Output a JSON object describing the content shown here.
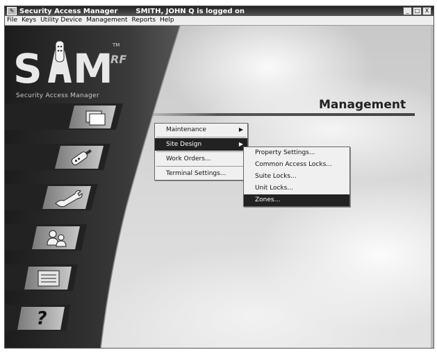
{
  "window": {
    "app_title": "Security Access Manager",
    "logged_on": "SMITH, JOHN Q is logged on",
    "buttons": {
      "minimize": "_",
      "maximize": "□",
      "close": "X"
    }
  },
  "menubar": [
    "File",
    "Keys",
    "Utility Device",
    "Management",
    "Reports",
    "Help"
  ],
  "logo": {
    "mark": "SAM",
    "trademark": "TM",
    "suffix": "RF",
    "tagline": "Security Access Manager"
  },
  "nav_tiles": [
    {
      "name": "folder-icon"
    },
    {
      "name": "key-device-icon"
    },
    {
      "name": "wrench-icon"
    },
    {
      "name": "users-icon"
    },
    {
      "name": "list-icon"
    },
    {
      "name": "help-icon",
      "glyph": "?"
    }
  ],
  "section": {
    "title": "Management"
  },
  "management_menu": {
    "items": [
      {
        "label": "Maintenance",
        "has_submenu": true
      },
      {
        "label": "Site Design",
        "has_submenu": true,
        "selected": true
      },
      {
        "label": "Work Orders..."
      },
      {
        "label": "Terminal Settings..."
      }
    ]
  },
  "site_design_submenu": {
    "items": [
      {
        "label": "Property Settings..."
      },
      {
        "label": "Common Access Locks..."
      },
      {
        "label": "Suite Locks..."
      },
      {
        "label": "Unit Locks..."
      },
      {
        "label": "Zones...",
        "selected": true
      }
    ]
  },
  "colors": {
    "titlebar": "#333333",
    "selection": "#222222",
    "panel": "#2a2a2a"
  }
}
